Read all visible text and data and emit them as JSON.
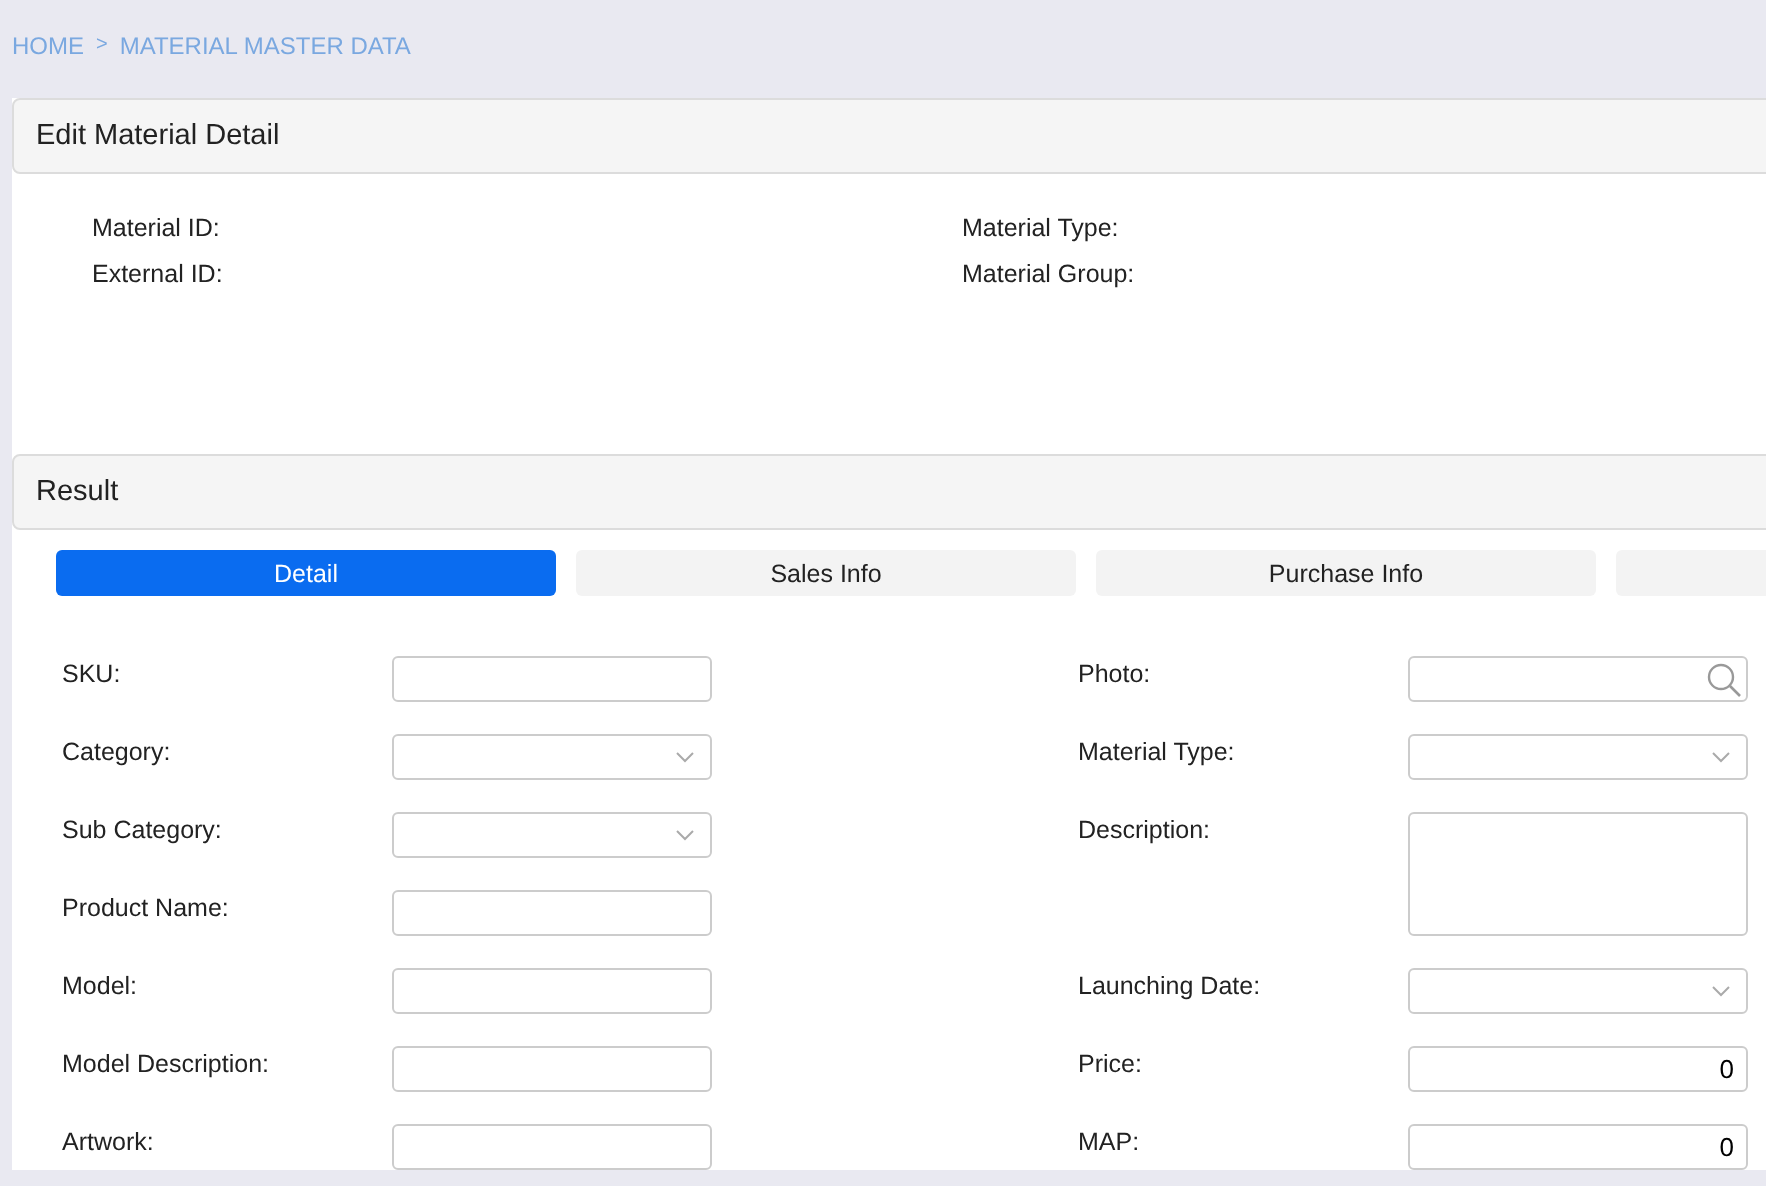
{
  "breadcrumb": {
    "items": [
      "HOME",
      "MATERIAL MASTER DATA"
    ],
    "separator": ">"
  },
  "edit_panel": {
    "title": "Edit Material Detail",
    "fields": [
      {
        "label": "Material ID:"
      },
      {
        "label": "Material Type:"
      },
      {
        "label": "External ID:"
      },
      {
        "label": "Material Group:"
      }
    ]
  },
  "result_panel": {
    "title": "Result"
  },
  "tabs": [
    {
      "label": "Detail",
      "selected": true
    },
    {
      "label": "Sales Info",
      "selected": false
    },
    {
      "label": "Purchase Info",
      "selected": false
    },
    {
      "selected": false
    }
  ],
  "form": {
    "left": [
      {
        "label": "SKU:",
        "kind": "text"
      },
      {
        "label": "Category:",
        "kind": "select"
      },
      {
        "label": "Sub Category:",
        "kind": "select"
      },
      {
        "label": "Product Name:",
        "kind": "text"
      },
      {
        "label": "Model:",
        "kind": "text"
      },
      {
        "label": "Model Description:",
        "kind": "text"
      },
      {
        "label": "Artwork:",
        "kind": "text"
      }
    ],
    "right": [
      {
        "label": "Photo:",
        "kind": "search"
      },
      {
        "label": "Material Type:",
        "kind": "select"
      },
      {
        "label": "Description:",
        "kind": "textarea"
      },
      {
        "label": "Launching Date:",
        "kind": "select"
      },
      {
        "label": "Price:",
        "kind": "number",
        "value": "0"
      },
      {
        "label": "MAP:",
        "kind": "number",
        "value": "0"
      }
    ]
  }
}
